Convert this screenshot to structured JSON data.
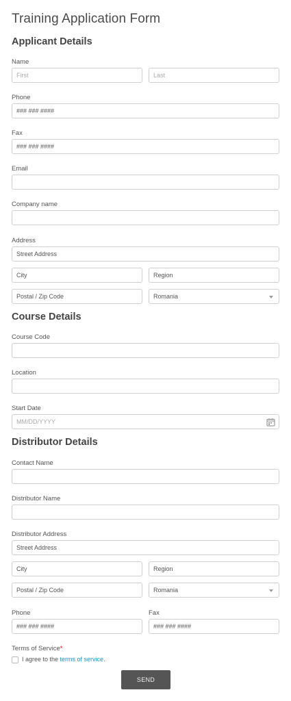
{
  "title": "Training Application Form",
  "sections": {
    "applicant": "Applicant Details",
    "course": "Course Details",
    "distributor": "Distributor Details"
  },
  "applicant": {
    "name_label": "Name",
    "first_placeholder": "First",
    "last_placeholder": "Last",
    "phone_label": "Phone",
    "phone_placeholder": "### ### ####",
    "fax_label": "Fax",
    "fax_placeholder": "### ### ####",
    "email_label": "Email",
    "company_label": "Company name",
    "address_label": "Address",
    "street_placeholder": "Street Address",
    "city_placeholder": "City",
    "region_placeholder": "Region",
    "postal_placeholder": "Postal / Zip Code",
    "country_value": "Romania"
  },
  "course": {
    "code_label": "Course Code",
    "location_label": "Location",
    "start_label": "Start Date",
    "start_placeholder": "MM/DD/YYYY"
  },
  "distributor": {
    "contact_label": "Contact Name",
    "name_label": "Distributor Name",
    "address_label": "Distributor Address",
    "street_placeholder": "Street Address",
    "city_placeholder": "City",
    "region_placeholder": "Region",
    "postal_placeholder": "Postal / Zip Code",
    "country_value": "Romania",
    "phone_label": "Phone",
    "phone_placeholder": "### ### ####",
    "fax_label": "Fax",
    "fax_placeholder": "### ### ####"
  },
  "terms": {
    "label": "Terms of Service",
    "required_mark": "*",
    "agree_prefix": "I agree to the ",
    "link_text": "terms of service",
    "agree_suffix": "."
  },
  "send_label": "SEND",
  "icons": {
    "calendar": "calendar-icon",
    "dropdown": "chevron-down-icon"
  }
}
